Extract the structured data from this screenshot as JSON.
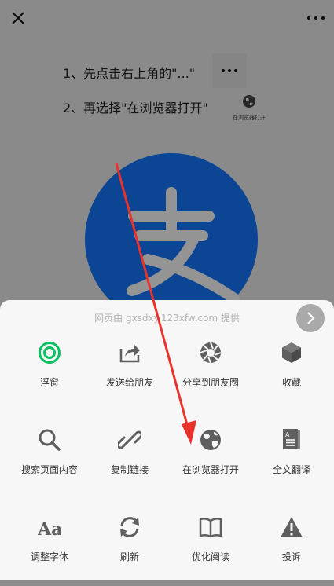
{
  "topbar": {
    "close_icon": "close-icon",
    "more_icon": "more-icon"
  },
  "instructions": {
    "line1": "1、先点击右上角的\"...\"",
    "line2": "2、再选择\"在浏览器打开\"",
    "mini_caption": "在浏览器打开"
  },
  "sheet": {
    "provider": "网页由 gxsdxy.123xfw.com 提供",
    "row1": [
      {
        "label": "浮窗",
        "icon": "floating-window-icon"
      },
      {
        "label": "发送给朋友",
        "icon": "share-icon"
      },
      {
        "label": "分享到朋友圈",
        "icon": "moments-icon"
      },
      {
        "label": "收藏",
        "icon": "favorite-icon"
      }
    ],
    "row2": [
      {
        "label": "搜索页面内容",
        "icon": "search-icon"
      },
      {
        "label": "复制链接",
        "icon": "link-icon"
      },
      {
        "label": "在浏览器打开",
        "icon": "globe-icon"
      },
      {
        "label": "全文翻译",
        "icon": "translate-icon"
      }
    ],
    "row3": [
      {
        "label": "调整字体",
        "icon": "font-icon",
        "glyph": "Aa"
      },
      {
        "label": "刷新",
        "icon": "refresh-icon"
      },
      {
        "label": "优化阅读",
        "icon": "book-icon"
      },
      {
        "label": "投诉",
        "icon": "warning-icon"
      }
    ]
  },
  "colors": {
    "accent_green": "#07c160",
    "arrow_red": "#e8332d",
    "icon_gray": "#5f5f5f"
  }
}
